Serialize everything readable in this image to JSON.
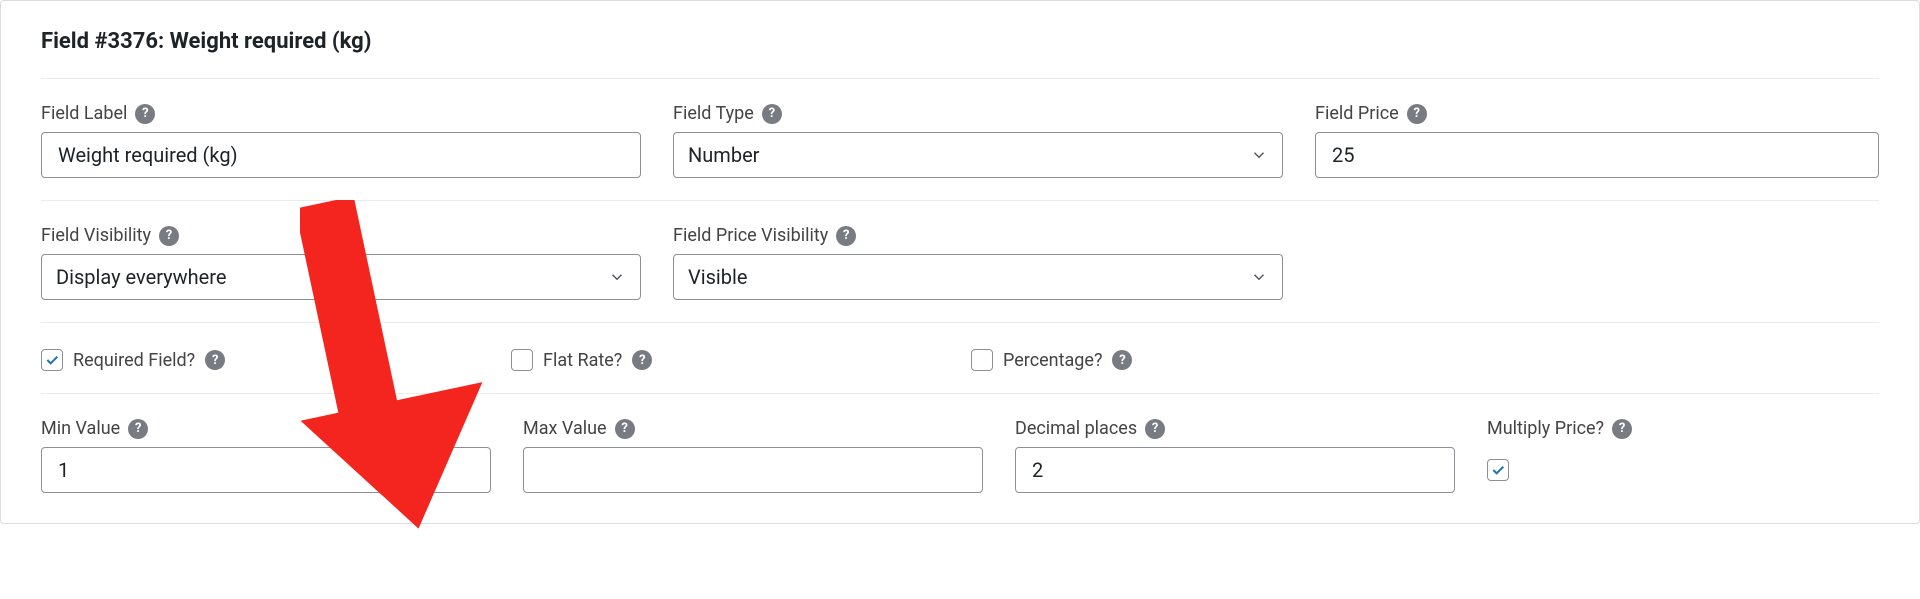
{
  "header": {
    "title": "Field #3376: Weight required (kg)"
  },
  "row1": {
    "field_label": {
      "label": "Field Label",
      "value": "Weight required (kg)"
    },
    "field_type": {
      "label": "Field Type",
      "value": "Number"
    },
    "field_price": {
      "label": "Field Price",
      "value": "25"
    }
  },
  "row2": {
    "field_visibility": {
      "label": "Field Visibility",
      "value": "Display everywhere"
    },
    "field_price_visibility": {
      "label": "Field Price Visibility",
      "value": "Visible"
    }
  },
  "checks": {
    "required": {
      "label": "Required Field?",
      "checked": true
    },
    "flat_rate": {
      "label": "Flat Rate?",
      "checked": false
    },
    "percentage": {
      "label": "Percentage?",
      "checked": false
    }
  },
  "row4": {
    "min_value": {
      "label": "Min Value",
      "value": "1"
    },
    "max_value": {
      "label": "Max Value",
      "value": ""
    },
    "decimal_places": {
      "label": "Decimal places",
      "value": "2"
    },
    "multiply_price": {
      "label": "Multiply Price?",
      "checked": true
    }
  },
  "annotation": {
    "color": "#f4241f"
  }
}
